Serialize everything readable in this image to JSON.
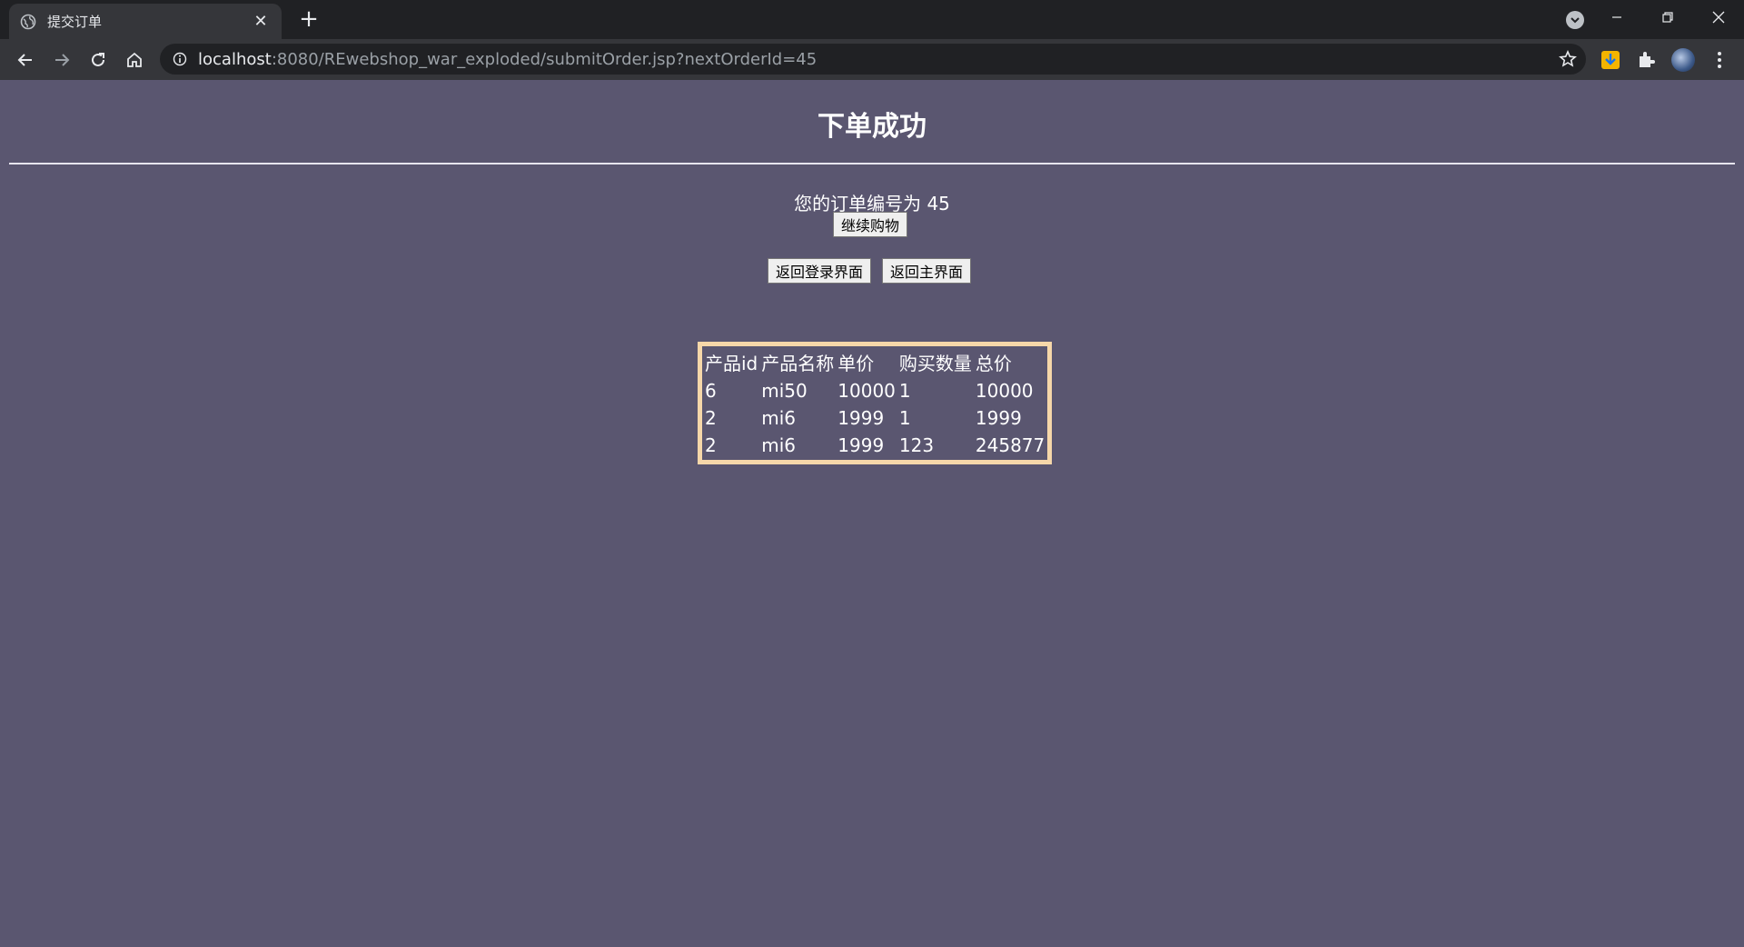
{
  "browser": {
    "tab_title": "提交订单",
    "url_host": "localhost",
    "url_rest": ":8080/REwebshop_war_exploded/submitOrder.jsp?nextOrderId=45"
  },
  "page": {
    "title": "下单成功",
    "order_message": "您的订单编号为 45",
    "continue_button": "继续购物",
    "back_login_button": "返回登录界面",
    "back_main_button": "返回主界面",
    "table": {
      "headers": [
        "产品id",
        "产品名称",
        "单价",
        "购买数量",
        "总价"
      ],
      "rows": [
        [
          "6",
          "mi50",
          "10000",
          "1",
          "10000"
        ],
        [
          "2",
          "mi6",
          "1999",
          "1",
          "1999"
        ],
        [
          "2",
          "mi6",
          "1999",
          "123",
          "245877"
        ]
      ]
    }
  },
  "colors": {
    "page_background": "#5a5670",
    "table_border": "#f6d7a9"
  }
}
